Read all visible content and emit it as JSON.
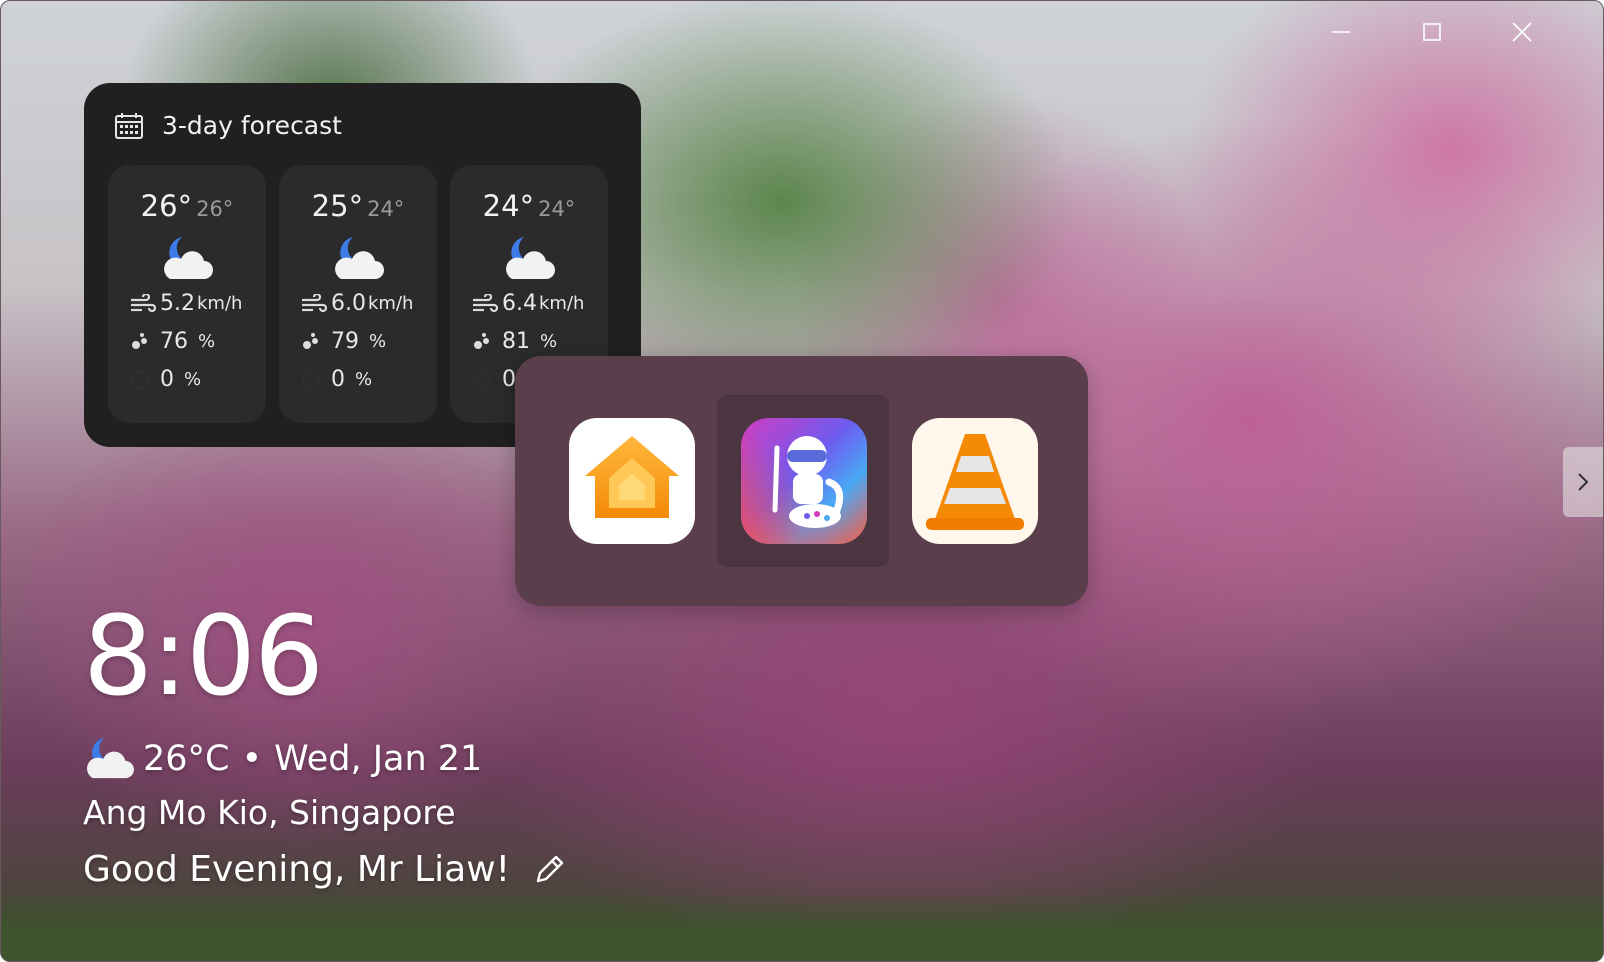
{
  "window": {
    "controls": [
      "minimize",
      "maximize",
      "close"
    ]
  },
  "forecast": {
    "title": "3-day forecast",
    "icon": "calendar-icon",
    "days": [
      {
        "high": "26°",
        "low": "26°",
        "condition_icon": "moon-cloud-icon",
        "wind": "5.2",
        "wind_unit": "km/h",
        "humidity": "76",
        "precip": "0",
        "unit_pct": "%"
      },
      {
        "high": "25°",
        "low": "24°",
        "condition_icon": "moon-cloud-icon",
        "wind": "6.0",
        "wind_unit": "km/h",
        "humidity": "79",
        "precip": "0",
        "unit_pct": "%"
      },
      {
        "high": "24°",
        "low": "24°",
        "condition_icon": "moon-cloud-icon",
        "wind": "6.4",
        "wind_unit": "km/h",
        "humidity": "81",
        "precip": "0",
        "unit_pct": "%"
      }
    ]
  },
  "dock": {
    "apps": [
      {
        "name": "Home",
        "icon": "home-app-icon"
      },
      {
        "name": "Drawing",
        "icon": "drawing-app-icon",
        "selected": true
      },
      {
        "name": "VLC",
        "icon": "vlc-cone-icon"
      }
    ]
  },
  "lockscreen": {
    "time": "8:06",
    "temperature": "26°C",
    "separator": "•",
    "date": "Wed, Jan 21",
    "location": "Ang Mo Kio, Singapore",
    "greeting": "Good Evening, Mr Liaw!"
  },
  "colors": {
    "panel": "#202020",
    "card": "#2b2b2b",
    "dock": "#5b3e4b",
    "text": "#ffffff"
  }
}
